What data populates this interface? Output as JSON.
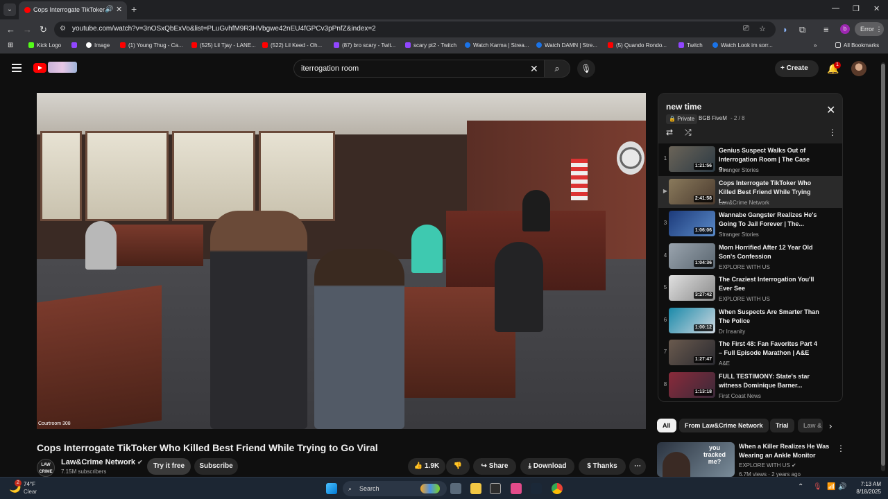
{
  "browser": {
    "tab_title": "Cops Interrogate TikToker Wh",
    "url": "youtube.com/watch?v=3nOSxQbExVo&list=PLuGvhfM9R3HVbgwe42nEU4fGPCv3pPnfZ&index=2",
    "error_label": "Error",
    "profile_letter": "b",
    "bookmarks": [
      {
        "label": "Kick Logo",
        "color": "#53fc18"
      },
      {
        "label": "",
        "color": "#9146ff"
      },
      {
        "label": "Image",
        "color": "#ffffff"
      },
      {
        "label": "(1) Young Thug - Ca...",
        "color": "#ff0000"
      },
      {
        "label": "(525) Lil Tjay - LANE...",
        "color": "#ff0000"
      },
      {
        "label": "(522) Lil Keed - Oh...",
        "color": "#ff0000"
      },
      {
        "label": "(87) bro scary - Twit...",
        "color": "#9146ff"
      },
      {
        "label": "scary pt2 - Twitch",
        "color": "#9146ff"
      },
      {
        "label": "Watch Karma | Strea...",
        "color": "#1a73e8"
      },
      {
        "label": "Watch DAMN | Stre...",
        "color": "#1a73e8"
      },
      {
        "label": "(5) Quando Rondo...",
        "color": "#ff0000"
      },
      {
        "label": "Twitch",
        "color": "#9146ff"
      },
      {
        "label": "Watch Look im sorr...",
        "color": "#1a73e8"
      }
    ],
    "all_bookmarks": "All Bookmarks"
  },
  "header": {
    "search_value": "iterrogation room",
    "create_label": "Create",
    "notifications": "1"
  },
  "video": {
    "title": "Cops Interrogate TikToker Who Killed Best Friend While Trying to Go Viral",
    "caption": "Courtroom 308",
    "channel": "Law&Crime Network",
    "channel_avatar": "LAW CRIME",
    "subscribers": "7.15M subscribers",
    "try_free": "Try it free",
    "subscribe": "Subscribe",
    "likes": "1.9K",
    "share": "Share",
    "download": "Download",
    "thanks": "Thanks"
  },
  "playlist": {
    "title": "new time",
    "privacy": "Private",
    "owner": "BGB FiveM",
    "position": "2 / 8",
    "items": [
      {
        "index": "1",
        "title": "Genius Suspect Walks Out of Interrogation Room | The Case o...",
        "channel": "Stranger Stories",
        "duration": "1:21:56",
        "colors": [
          "#6b6458",
          "#2c3a44"
        ]
      },
      {
        "index": "▶",
        "title": "Cops Interrogate TikToker Who Killed Best Friend While Trying t...",
        "channel": "Law&Crime Network",
        "duration": "2:41:58",
        "colors": [
          "#8a7a5c",
          "#4a3a2e"
        ]
      },
      {
        "index": "3",
        "title": "Wannabe Gangster Realizes He's Going To Jail Forever | The...",
        "channel": "Stranger Stories",
        "duration": "1:06:06",
        "colors": [
          "#1c3a7a",
          "#5a8ac8"
        ]
      },
      {
        "index": "4",
        "title": "Mom Horrified After 12 Year Old Son's Confession",
        "channel": "EXPLORE WITH US",
        "duration": "1:04:36",
        "colors": [
          "#9aa4ae",
          "#5a6670"
        ]
      },
      {
        "index": "5",
        "title": "The Craziest Interrogation You'll Ever See",
        "channel": "EXPLORE WITH US",
        "duration": "3:27:42",
        "colors": [
          "#e0e0e0",
          "#8a8a8a"
        ]
      },
      {
        "index": "6",
        "title": "When Suspects Are Smarter Than The Police",
        "channel": "Dr Insanity",
        "duration": "1:00:12",
        "colors": [
          "#1a8aaa",
          "#d0d8e0"
        ]
      },
      {
        "index": "7",
        "title": "The First 48: Fan Favorites Part 4 – Full Episode Marathon | A&E",
        "channel": "A&E",
        "duration": "1:27:47",
        "colors": [
          "#6a5a4e",
          "#2a2a30"
        ]
      },
      {
        "index": "8",
        "title": "FULL TESTIMONY: State's star witness Dominique Barner...",
        "channel": "First Coast News",
        "duration": "1:13:18",
        "colors": [
          "#8a2a3a",
          "#3a2a3a"
        ]
      }
    ]
  },
  "chips": [
    "All",
    "From Law&Crime Network",
    "Trial",
    "Law &"
  ],
  "recommendation": {
    "title": "When a Killer Realizes He Was Wearing an Ankle Monitor",
    "channel": "EXPLORE WITH US",
    "meta": "6.7M views · 2 years ago",
    "thumb_text": "you tracked me?"
  },
  "taskbar": {
    "temperature": "74°F",
    "weather": "Clear",
    "weather_badge": "2",
    "search_label": "Search",
    "time": "7:13 AM",
    "date": "8/18/2025"
  }
}
